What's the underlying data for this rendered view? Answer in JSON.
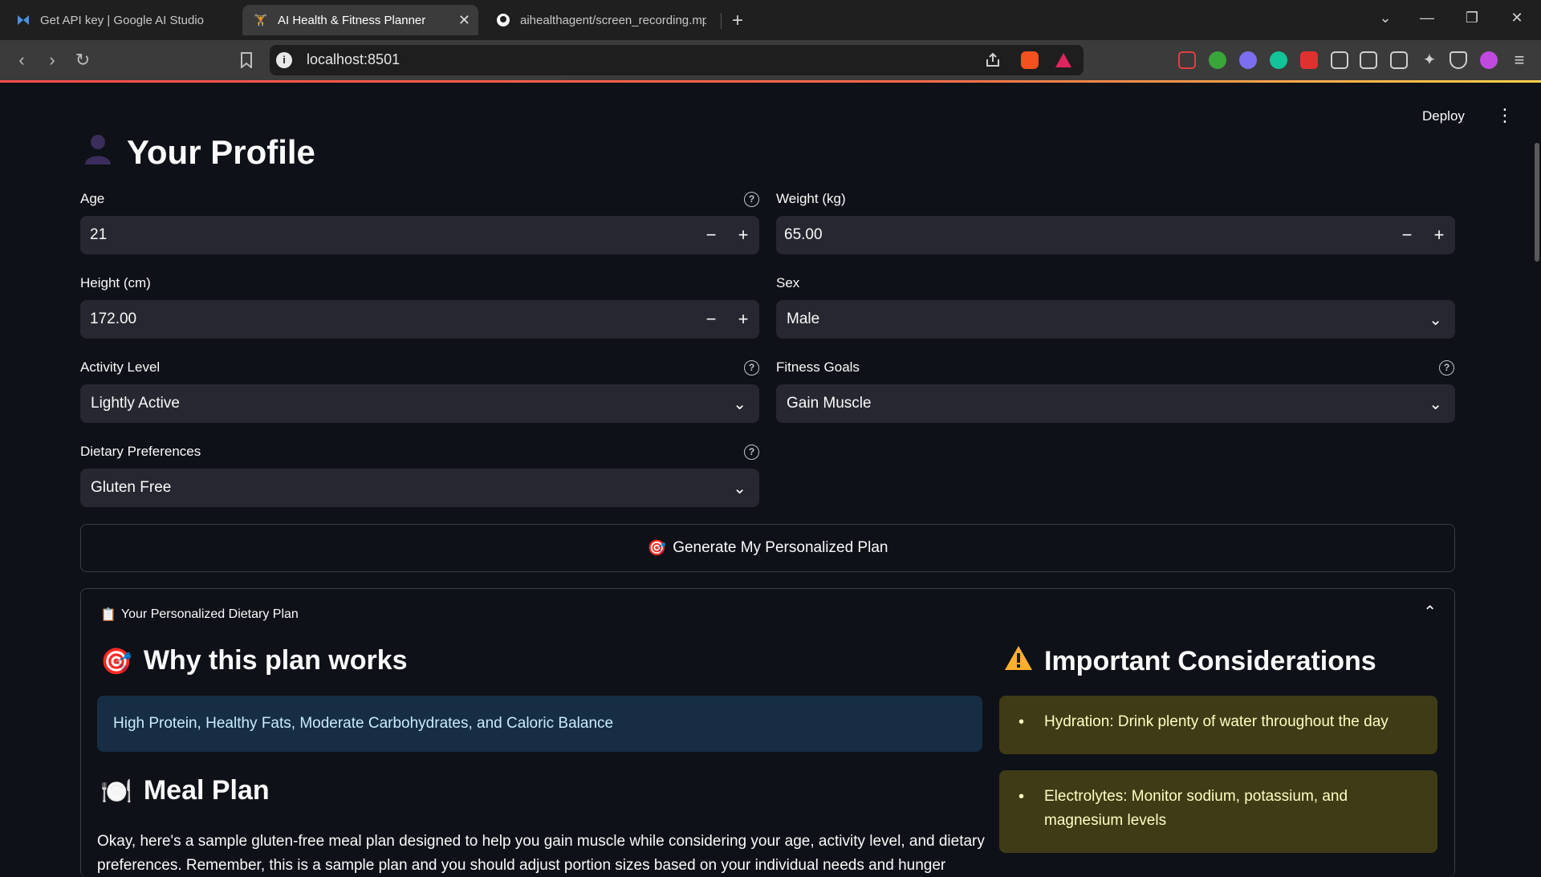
{
  "browser": {
    "tabs": [
      {
        "title": "Get API key | Google AI Studio",
        "active": false
      },
      {
        "title": "AI Health & Fitness Planner",
        "active": true
      },
      {
        "title": "aihealthagent/screen_recording.mp",
        "active": false
      }
    ],
    "url": "localhost:8501"
  },
  "app": {
    "deploy_label": "Deploy",
    "profile_heading": "Your Profile",
    "fields": {
      "age": {
        "label": "Age",
        "value": "21"
      },
      "weight": {
        "label": "Weight (kg)",
        "value": "65.00"
      },
      "height": {
        "label": "Height (cm)",
        "value": "172.00"
      },
      "sex": {
        "label": "Sex",
        "value": "Male"
      },
      "activity": {
        "label": "Activity Level",
        "value": "Lightly Active"
      },
      "goals": {
        "label": "Fitness Goals",
        "value": "Gain Muscle"
      },
      "diet": {
        "label": "Dietary Preferences",
        "value": "Gluten Free"
      }
    },
    "generate_button": "Generate My Personalized Plan",
    "expander": {
      "title": "Your Personalized Dietary Plan",
      "why_heading": "Why this plan works",
      "why_text": "High Protein, Healthy Fats, Moderate Carbohydrates, and Caloric Balance",
      "meal_heading": "Meal Plan",
      "meal_text": "Okay, here's a sample gluten-free meal plan designed to help you gain muscle while considering your age, activity level, and dietary preferences. Remember, this is a sample plan and you should adjust portion sizes based on your individual needs and hunger levels.",
      "considerations_heading": "Important Considerations",
      "considerations": [
        "Hydration: Drink plenty of water throughout the day",
        "Electrolytes: Monitor sodium, potassium, and magnesium levels"
      ]
    }
  },
  "colors": {
    "background": "#0e1117",
    "input_bg": "#262730",
    "info_bg": "#172d43",
    "warning_bg": "#3e3b16",
    "accent_red": "#ff4b4b"
  }
}
